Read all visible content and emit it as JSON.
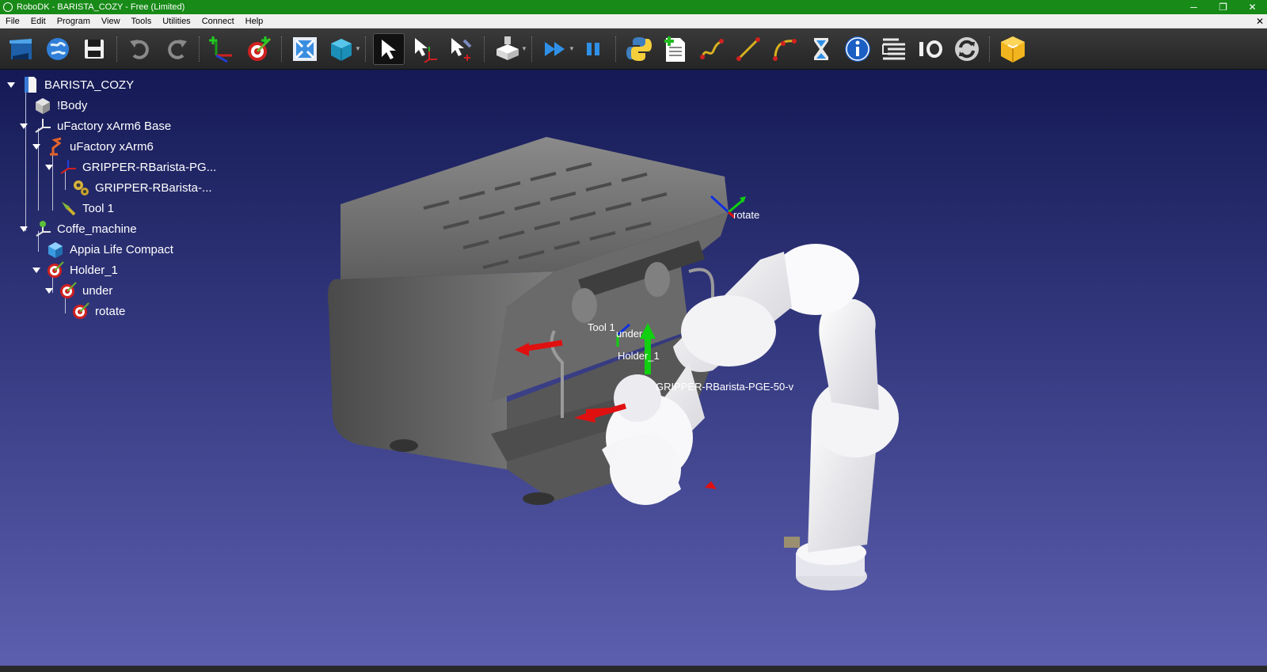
{
  "window": {
    "title": "RoboDK - BARISTA_COZY - Free (Limited)",
    "title_bar_color": "#178a17",
    "controls": {
      "minimize": "─",
      "restore": "❐",
      "close": "✕"
    }
  },
  "menu": {
    "items": [
      "File",
      "Edit",
      "Program",
      "View",
      "Tools",
      "Utilities",
      "Connect",
      "Help"
    ],
    "close_glyph": "✕"
  },
  "toolbar": {
    "buttons": [
      "open-station-icon",
      "online-library-icon",
      "save-icon",
      "undo-icon",
      "redo-icon",
      "add-reference-frame-icon",
      "add-target-icon",
      "fit-all-icon",
      "view-cube-icon",
      "select-icon",
      "move-reference-icon",
      "move-tool-icon",
      "teach-target-icon",
      "run-simulation-icon",
      "pause-icon",
      "python-program-icon",
      "add-program-icon",
      "joint-move-icon",
      "linear-move-icon",
      "circular-move-icon",
      "pause-instruction-icon",
      "message-icon",
      "program-call-icon",
      "io-icon",
      "refresh-icon",
      "export-icon"
    ]
  },
  "tree": {
    "items": [
      {
        "label": "BARISTA_COZY",
        "icon": "station-icon",
        "expanded": true,
        "depth": 0
      },
      {
        "label": "!Body",
        "icon": "object-icon",
        "depth": 1
      },
      {
        "label": "uFactory xArm6 Base",
        "icon": "reference-frame-icon",
        "expanded": true,
        "depth": 1
      },
      {
        "label": "uFactory xArm6",
        "icon": "robot-icon",
        "expanded": true,
        "depth": 2
      },
      {
        "label": "GRIPPER-RBarista-PG...",
        "icon": "reference-frame-icon",
        "expanded": true,
        "depth": 3
      },
      {
        "label": "GRIPPER-RBarista-...",
        "icon": "mechanism-icon",
        "depth": 4
      },
      {
        "label": "Tool 1",
        "icon": "tool-icon",
        "depth": 3
      },
      {
        "label": "Coffe_machine",
        "icon": "reference-frame-icon",
        "expanded": true,
        "depth": 1
      },
      {
        "label": "Appia Life Compact",
        "icon": "object-icon",
        "depth": 2
      },
      {
        "label": "Holder_1",
        "icon": "target-icon",
        "expanded": true,
        "depth": 2
      },
      {
        "label": "under",
        "icon": "target-icon",
        "expanded": true,
        "depth": 3
      },
      {
        "label": "rotate",
        "icon": "target-icon",
        "depth": 4
      }
    ]
  },
  "scene_labels": {
    "rotate": "rotate",
    "tool": "Tool 1",
    "under": "under",
    "holder": "Holder_1",
    "gripper": "GRIPPER-RBarista-PGE-50-v"
  },
  "colors": {
    "background_top": "#151a55",
    "background_bottom": "#5c5fae",
    "axis_x": "#e01010",
    "axis_y": "#10d010",
    "axis_z": "#1030e0"
  }
}
